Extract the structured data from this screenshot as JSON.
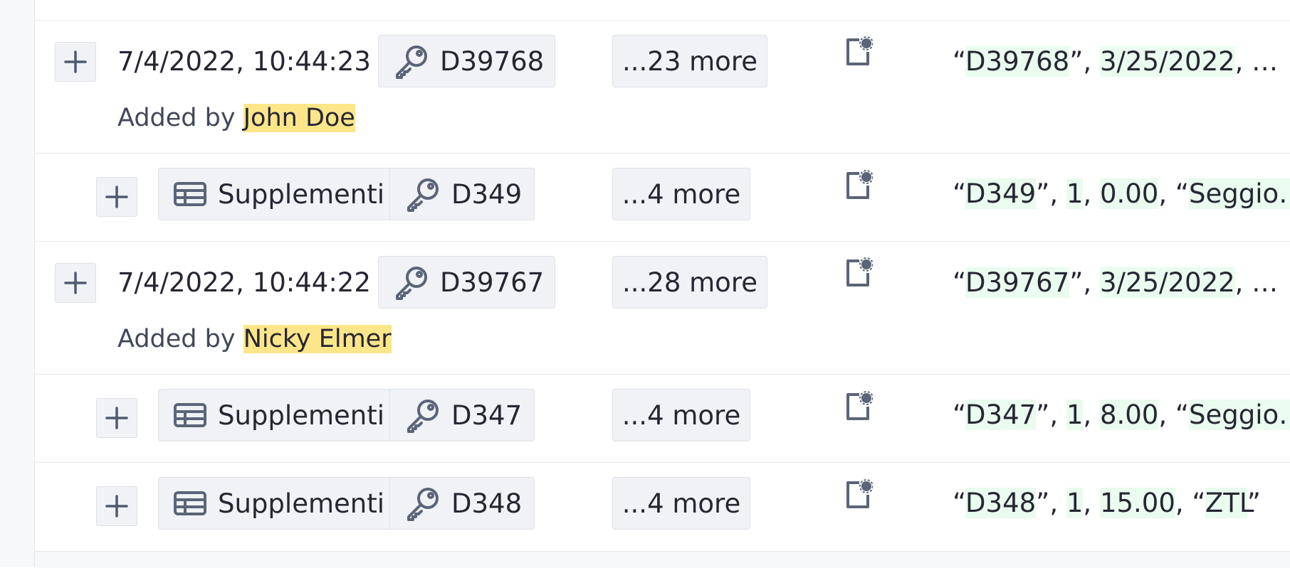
{
  "rows": [
    {
      "timestamp": "7/4/2022, 10:44:23",
      "record_id": "D39768",
      "more": "...23 more",
      "added_by_prefix": "Added by",
      "added_by_user": "John Doe",
      "values": {
        "p0": "“",
        "v0": "D39768",
        "p1": "”, ",
        "v1": "3/25/2022",
        "p2": ", …"
      }
    },
    {
      "table_name": "Supplementi",
      "record_id": "D349",
      "more": "...4 more",
      "values": {
        "p0": "“",
        "v0": "D349",
        "p1": "”, ",
        "v1": "1",
        "p2": ", ",
        "v2": "0.00",
        "p3": ", “",
        "v3": "Seggio…"
      }
    },
    {
      "timestamp": "7/4/2022, 10:44:22",
      "record_id": "D39767",
      "more": "...28 more",
      "added_by_prefix": "Added by",
      "added_by_user": "Nicky Elmer",
      "values": {
        "p0": "“",
        "v0": "D39767",
        "p1": "”, ",
        "v1": "3/25/2022",
        "p2": ", …"
      }
    },
    {
      "table_name": "Supplementi",
      "record_id": "D347",
      "more": "...4 more",
      "values": {
        "p0": "“",
        "v0": "D347",
        "p1": "”, ",
        "v1": "1",
        "p2": ", ",
        "v2": "8.00",
        "p3": ", “",
        "v3": "Seggio…"
      }
    },
    {
      "table_name": "Supplementi",
      "record_id": "D348",
      "more": "...4 more",
      "values": {
        "p0": "“",
        "v0": "D348",
        "p1": "”, ",
        "v1": "1",
        "p2": ", ",
        "v2": "15.00",
        "p3": ", “",
        "v3": "ZTL",
        "p4": "”"
      }
    }
  ],
  "icons": {
    "expand": "plus-icon",
    "key": "key-icon",
    "table": "table-icon",
    "document": "document-badge-icon"
  },
  "colors": {
    "value_highlight": "#e9fcef",
    "user_highlight": "#fde68a",
    "chip_background": "#f0f2f5",
    "icon": "#5b6478"
  }
}
